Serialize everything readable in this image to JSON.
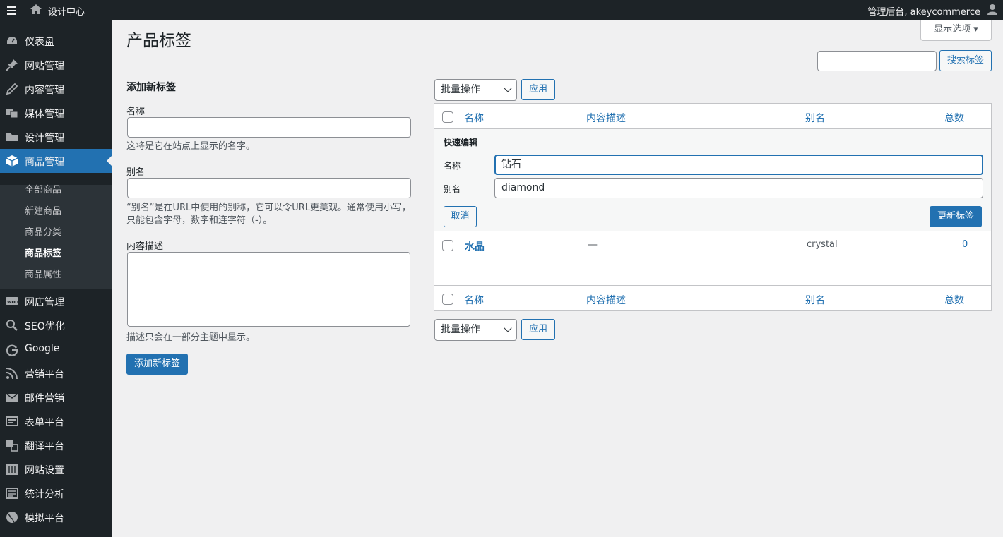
{
  "adminbar": {
    "site_name": "设计中心",
    "account": "管理后台, akeycommerce"
  },
  "sidebar": {
    "items": [
      {
        "label": "仪表盘",
        "icon": "dashboard-icon"
      },
      {
        "label": "网站管理",
        "icon": "pin-icon"
      },
      {
        "label": "内容管理",
        "icon": "edit-icon"
      },
      {
        "label": "媒体管理",
        "icon": "media-icon"
      },
      {
        "label": "设计管理",
        "icon": "folder-icon"
      },
      {
        "label": "商品管理",
        "icon": "box-icon"
      },
      {
        "label": "网店管理",
        "icon": "woo-icon"
      },
      {
        "label": "SEO优化",
        "icon": "search-icon"
      },
      {
        "label": "Google",
        "icon": "google-icon"
      },
      {
        "label": "营销平台",
        "icon": "rss-icon"
      },
      {
        "label": "邮件营销",
        "icon": "mail-icon"
      },
      {
        "label": "表单平台",
        "icon": "form-icon"
      },
      {
        "label": "翻译平台",
        "icon": "translate-icon"
      },
      {
        "label": "网站设置",
        "icon": "settings-icon"
      },
      {
        "label": "统计分析",
        "icon": "analytics-icon"
      },
      {
        "label": "模拟平台",
        "icon": "globe-icon"
      }
    ],
    "submenu": [
      "全部商品",
      "新建商品",
      "商品分类",
      "商品标签",
      "商品属性"
    ]
  },
  "page": {
    "title": "产品标签",
    "screen_options": "显示选项",
    "search_button": "搜索标签"
  },
  "add_form": {
    "title": "添加新标签",
    "name_label": "名称",
    "name_help": "这将是它在站点上显示的名字。",
    "slug_label": "别名",
    "slug_help_1": "“别名”是在URL中使用的别称，它可以令URL更美观。通常使用小写，",
    "slug_help_2": "只能包含字母，数字和连字符（-）。",
    "desc_label": "内容描述",
    "desc_help": "描述只会在一部分主题中显示。",
    "submit": "添加新标签"
  },
  "bulk": {
    "select": "批量操作",
    "apply": "应用"
  },
  "table": {
    "columns": [
      "名称",
      "内容描述",
      "别名",
      "总数"
    ],
    "quick_edit": {
      "title": "快速编辑",
      "name_label": "名称",
      "name_value": "钻石",
      "slug_label": "别名",
      "slug_value": "diamond",
      "cancel": "取消",
      "update": "更新标签"
    },
    "rows": [
      {
        "name": "水晶",
        "description": "—",
        "slug": "crystal",
        "count": "0"
      }
    ]
  },
  "colors": {
    "accent": "#2271b1",
    "sidebar_bg": "#1d2327",
    "page_bg": "#f0f0f1"
  }
}
